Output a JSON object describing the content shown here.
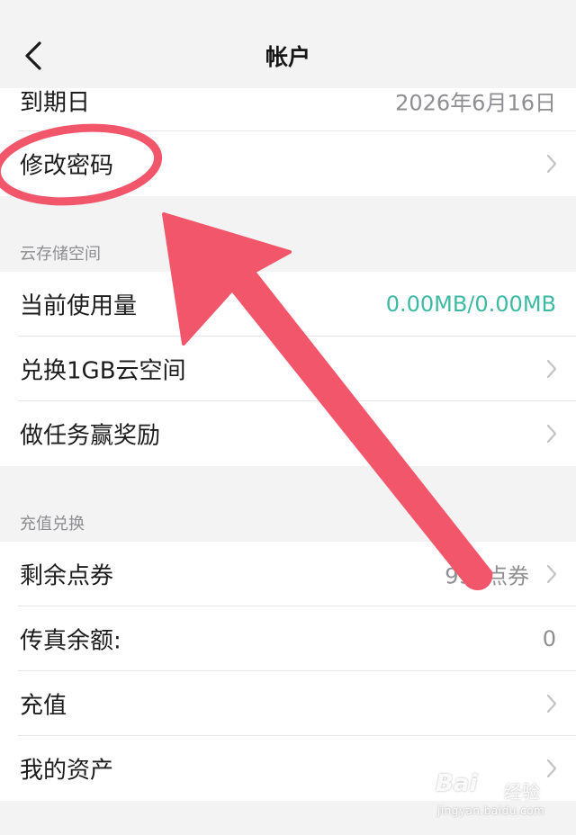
{
  "navbar": {
    "title": "帐户",
    "back_icon": "chevron-left-icon"
  },
  "account": {
    "items": [
      {
        "label": "到期日",
        "value": "2026年6月16日",
        "chevron": false
      },
      {
        "label": "修改密码",
        "value": "",
        "chevron": true
      }
    ]
  },
  "storage": {
    "header": "云存储空间",
    "items": [
      {
        "label": "当前使用量",
        "value": "0.00MB/0.00MB",
        "chevron": false,
        "accent": true
      },
      {
        "label": "兑换1GB云空间",
        "value": "",
        "chevron": true
      },
      {
        "label": "做任务赢奖励",
        "value": "",
        "chevron": true
      }
    ]
  },
  "recharge": {
    "header": "充值兑换",
    "items": [
      {
        "label": "剩余点券",
        "value": "999点券",
        "chevron": true
      },
      {
        "label": "传真余额:",
        "value": "0",
        "chevron": false
      },
      {
        "label": "充值",
        "value": "",
        "chevron": true
      },
      {
        "label": "我的资产",
        "value": "",
        "chevron": true
      }
    ]
  },
  "annotation": {
    "color": "#f2566b",
    "shapes": [
      "red-ellipse-highlight",
      "red-arrow"
    ]
  },
  "watermark": {
    "logo": "Bai",
    "suffix": "经验",
    "url": "jingyan.baidu.com"
  },
  "colors": {
    "background": "#f3f3f4",
    "accent": "#3dbaa4",
    "secondary_text": "#8e8e93"
  }
}
